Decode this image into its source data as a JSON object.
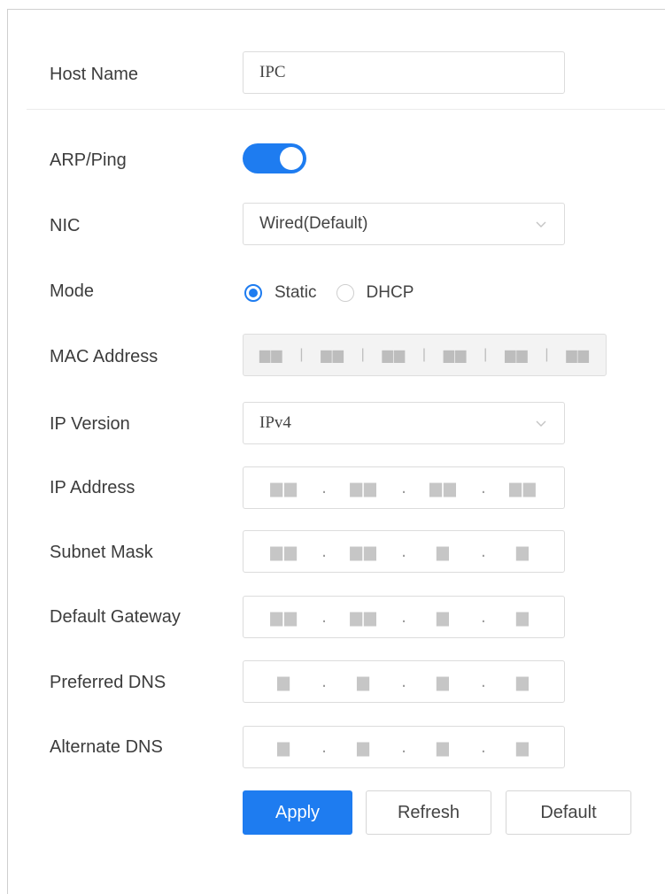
{
  "host": {
    "label": "Host Name",
    "value": "IPC"
  },
  "arp_ping": {
    "label": "ARP/Ping",
    "enabled": true
  },
  "nic": {
    "label": "NIC",
    "value": "Wired(Default)"
  },
  "mode": {
    "label": "Mode",
    "options": [
      "Static",
      "DHCP"
    ],
    "selected": "Static"
  },
  "mac": {
    "label": "MAC Address",
    "octets": [
      "▆▆",
      "▆▆",
      "▆▆",
      "▆▆",
      "▆▆",
      "▆▆"
    ]
  },
  "ip_version": {
    "label": "IP Version",
    "value": "IPv4"
  },
  "ip_address": {
    "label": "IP Address",
    "octets": [
      "▆▆",
      "▆▆",
      "▆▆",
      "▆▆"
    ]
  },
  "subnet": {
    "label": "Subnet Mask",
    "octets": [
      "▆▆",
      "▆▆",
      "▆",
      "▆"
    ]
  },
  "gateway": {
    "label": "Default Gateway",
    "octets": [
      "▆▆",
      "▆▆",
      "▆",
      "▆"
    ]
  },
  "dns1": {
    "label": "Preferred DNS",
    "octets": [
      "▆",
      "▆",
      "▆",
      "▆"
    ]
  },
  "dns2": {
    "label": "Alternate DNS",
    "octets": [
      "▆",
      "▆",
      "▆",
      "▆"
    ]
  },
  "buttons": {
    "apply": "Apply",
    "refresh": "Refresh",
    "default": "Default"
  },
  "colors": {
    "accent": "#1e7cf0",
    "border": "#dcdcdc",
    "disabled_bg": "#f3f3f3"
  }
}
